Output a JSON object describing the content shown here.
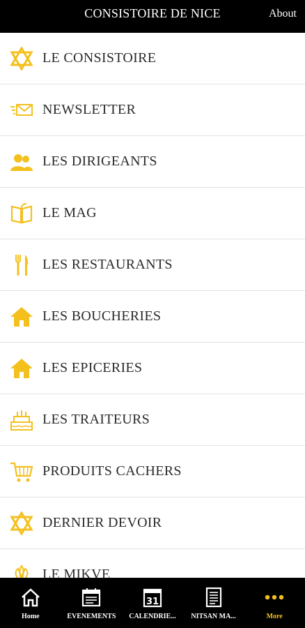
{
  "header": {
    "title": "CONSISTOIRE DE NICE",
    "about_label": "About"
  },
  "accent_color": "#f4c01e",
  "menu": {
    "items": [
      {
        "label": "LE CONSISTOIRE",
        "icon": "star-of-david-icon"
      },
      {
        "label": "NEWSLETTER",
        "icon": "envelope-icon"
      },
      {
        "label": "LES DIRIGEANTS",
        "icon": "people-icon"
      },
      {
        "label": "LE MAG",
        "icon": "open-book-icon"
      },
      {
        "label": "LES RESTAURANTS",
        "icon": "fork-knife-icon"
      },
      {
        "label": "LES BOUCHERIES",
        "icon": "house-icon"
      },
      {
        "label": "LES EPICERIES",
        "icon": "house-icon"
      },
      {
        "label": "LES TRAITEURS",
        "icon": "cake-icon"
      },
      {
        "label": "PRODUITS CACHERS",
        "icon": "cart-icon"
      },
      {
        "label": "DERNIER DEVOIR",
        "icon": "star-of-david-icon"
      },
      {
        "label": "LE MIKVE",
        "icon": "flower-icon"
      }
    ]
  },
  "tabbar": {
    "tabs": [
      {
        "label": "Home",
        "icon": "home-icon"
      },
      {
        "label": "ÉVÉNEMENTS",
        "icon": "calendar-board-icon"
      },
      {
        "label": "CALENDRIE...",
        "icon": "calendar-31-icon",
        "icon_text": "31"
      },
      {
        "label": "NITSAN MA...",
        "icon": "document-icon"
      },
      {
        "label": "More",
        "icon": "more-dots-icon",
        "active": true
      }
    ]
  }
}
